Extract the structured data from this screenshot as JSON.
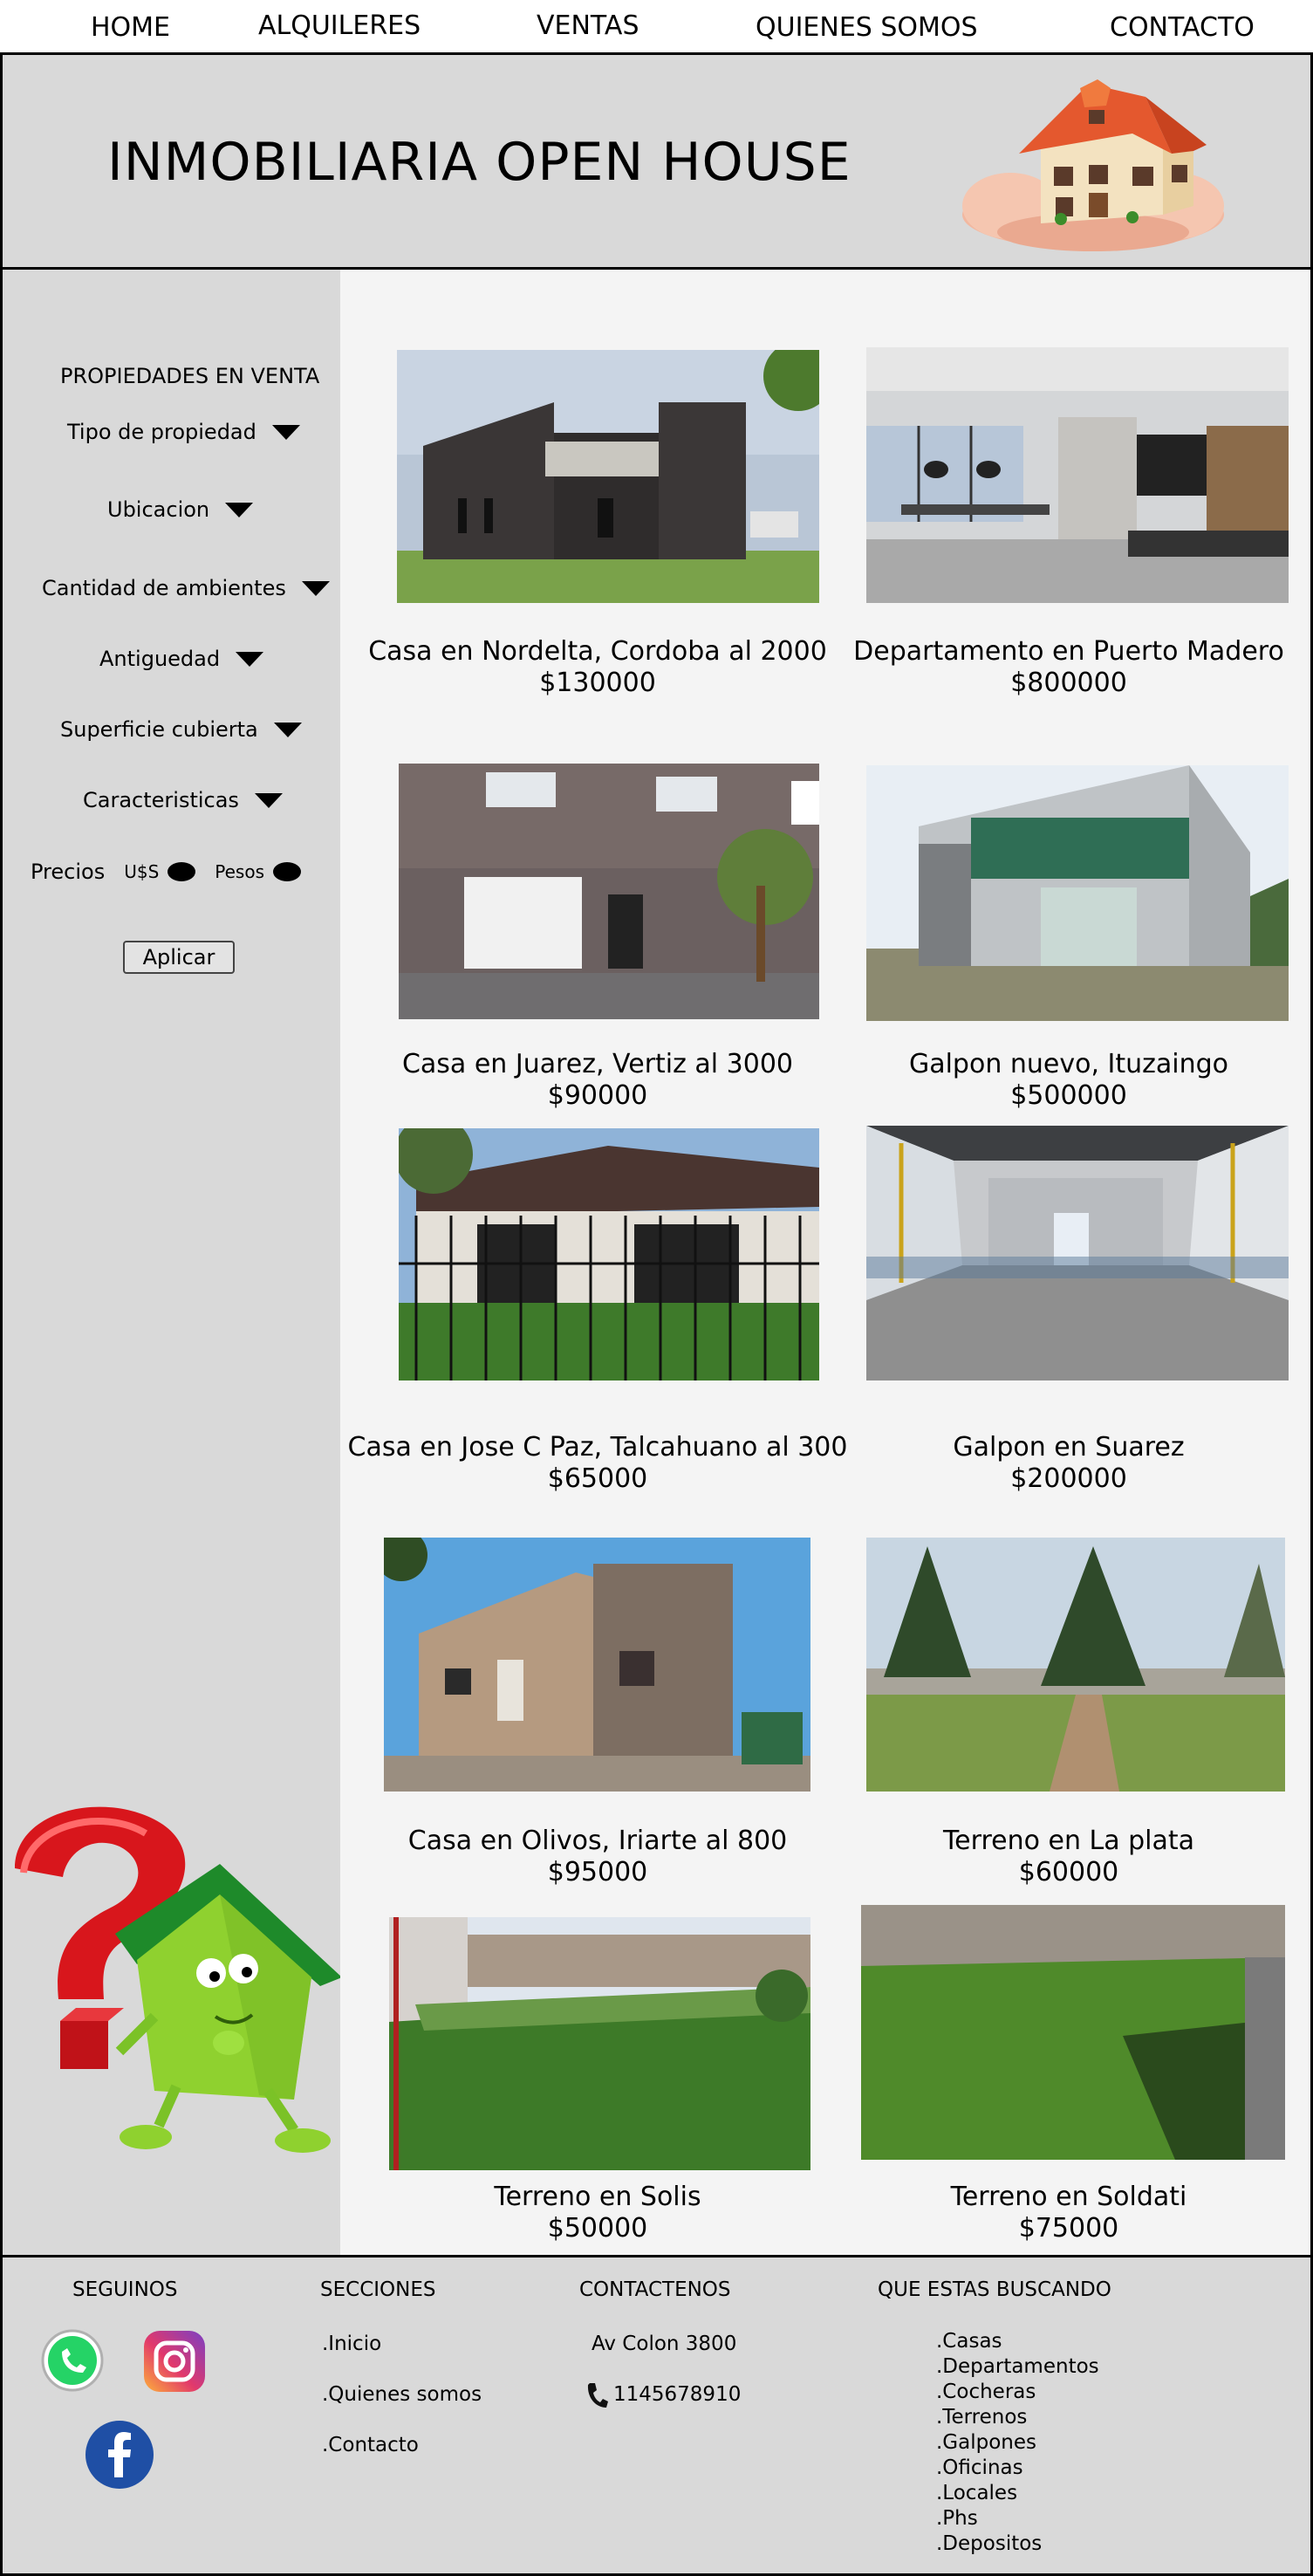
{
  "nav": {
    "items": [
      "HOME",
      "ALQUILERES",
      "VENTAS",
      "QUIENES SOMOS",
      "CONTACTO"
    ]
  },
  "header": {
    "title": "INMOBILIARIA OPEN HOUSE"
  },
  "sidebar": {
    "heading": "PROPIEDADES EN VENTA",
    "filters": [
      "Tipo de propiedad",
      "Ubicacion",
      "Cantidad de ambientes",
      "Antiguedad",
      "Superficie cubierta",
      "Caracteristicas"
    ],
    "prices": {
      "label": "Precios",
      "usd": "U$S",
      "pesos": "Pesos"
    },
    "apply_label": "Aplicar"
  },
  "listings": [
    {
      "title": "Casa en Nordelta, Cordoba al 2000",
      "price": "$130000"
    },
    {
      "title": "Departamento en Puerto Madero",
      "price": "$800000"
    },
    {
      "title": "Casa en Juarez, Vertiz al 3000",
      "price": "$90000"
    },
    {
      "title": "Galpon nuevo, Ituzaingo",
      "price": "$500000"
    },
    {
      "title": "Casa en Jose C Paz, Talcahuano al 300",
      "price": "$65000"
    },
    {
      "title": "Galpon en Suarez",
      "price": "$200000"
    },
    {
      "title": "Casa en Olivos, Iriarte al 800",
      "price": "$95000"
    },
    {
      "title": "Terreno en La plata",
      "price": "$60000"
    },
    {
      "title": "Terreno en Solis",
      "price": "$50000"
    },
    {
      "title": "Terreno en Soldati",
      "price": "$75000"
    }
  ],
  "footer": {
    "follow_heading": "SEGUINOS",
    "social": [
      "whatsapp-icon",
      "instagram-icon",
      "facebook-icon"
    ],
    "sections_heading": "SECCIONES",
    "sections": [
      ".Inicio",
      ".Quienes somos",
      ".Contacto"
    ],
    "contact_heading": "CONTACTENOS",
    "address": "Av Colon 3800",
    "phone": "1145678910",
    "search_heading": "QUE ESTAS BUSCANDO",
    "search_items": [
      ".Casas",
      ".Departamentos",
      ".Cocheras",
      ".Terrenos",
      ".Galpones",
      ".Oficinas",
      ".Locales",
      ".Phs",
      ".Depositos"
    ]
  },
  "colors": {
    "panel": "#d9d9d9",
    "main_bg": "#f4f4f4",
    "whatsapp": "#25d366",
    "facebook": "#1f4fa5",
    "roof": "#e4582e",
    "question_mark": "#d8161c",
    "green_house": "#8fd12f"
  }
}
